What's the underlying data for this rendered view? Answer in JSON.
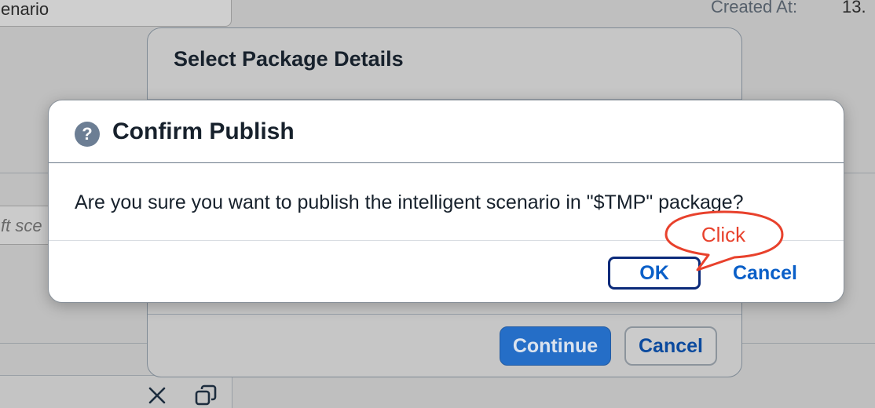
{
  "background": {
    "scenario_fragment": "enario",
    "created_at_label": "Created At:",
    "created_at_value": "13.",
    "search_fragment": "ft sce"
  },
  "package_dialog": {
    "title": "Select Package Details",
    "continue_label": "Continue",
    "cancel_label": "Cancel"
  },
  "confirm_dialog": {
    "icon_glyph": "?",
    "title": "Confirm Publish",
    "message": "Are you sure you want to publish the intelligent scenario in \"$TMP\" package?",
    "ok_label": "OK",
    "cancel_label": "Cancel"
  },
  "annotation": {
    "text": "Click",
    "color": "#e8412c"
  },
  "icons": {
    "close": "close-icon",
    "copy": "copy-icon",
    "question": "question-icon"
  },
  "colors": {
    "accent": "#0a5fc8",
    "ok_border": "#0b2a7a",
    "overlay": "#bfbfbf"
  }
}
